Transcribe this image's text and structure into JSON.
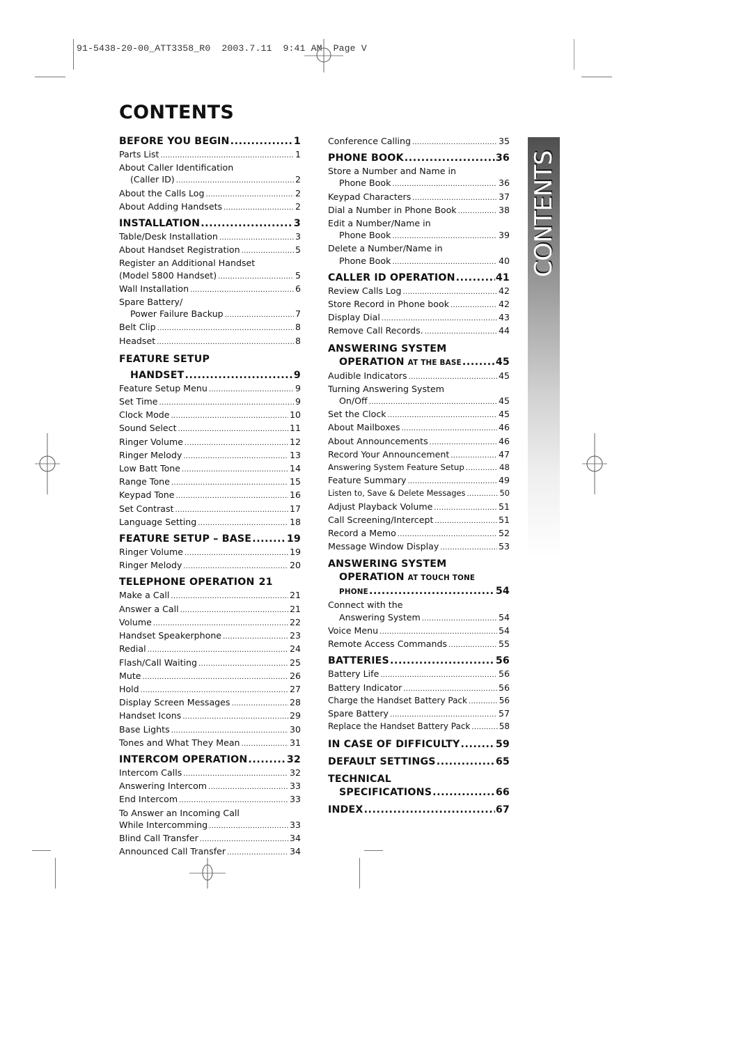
{
  "slug": {
    "text": "91-5438-20-00_ATT3358_R0  2003.7.11  9:41 AM  Page V"
  },
  "page_title": "CONTENTS",
  "side_tab_label": "CONTENTS",
  "left_column": [
    {
      "heading": "BEFORE YOU BEGIN",
      "page": "1",
      "entries": [
        {
          "title": "Parts List",
          "page": "1"
        },
        {
          "title": "About Caller Identification",
          "page": null
        },
        {
          "title": "(Caller ID)",
          "page": "2",
          "indent": true
        },
        {
          "title": "About the Calls Log",
          "page": "2"
        },
        {
          "title": "About Adding Handsets",
          "page": "2"
        }
      ]
    },
    {
      "heading": "INSTALLATION",
      "page": "3",
      "entries": [
        {
          "title": "Table/Desk Installation",
          "page": "3"
        },
        {
          "title": "About Handset Registration",
          "page": "5"
        },
        {
          "title": "Register an Additional Handset",
          "page": null
        },
        {
          "title": "(Model 5800 Handset)",
          "page": "5"
        },
        {
          "title": "Wall Installation",
          "page": "6"
        },
        {
          "title": "Spare Battery/",
          "page": null
        },
        {
          "title": "Power Failure Backup",
          "page": "7",
          "indent": true
        },
        {
          "title": "Belt Clip",
          "page": "8"
        },
        {
          "title": "Headset",
          "page": "8"
        }
      ]
    },
    {
      "heading": "FEATURE SETUP",
      "heading_line2": "HANDSET",
      "page": "9",
      "entries": [
        {
          "title": "Feature Setup Menu",
          "page": "9"
        },
        {
          "title": "Set Time",
          "page": "9"
        },
        {
          "title": "Clock Mode",
          "page": "10"
        },
        {
          "title": "Sound Select",
          "page": "11"
        },
        {
          "title": "Ringer Volume",
          "page": "12"
        },
        {
          "title": "Ringer Melody",
          "page": "13"
        },
        {
          "title": "Low Batt Tone",
          "page": "14"
        },
        {
          "title": "Range Tone",
          "page": "15"
        },
        {
          "title": "Keypad Tone",
          "page": "16"
        },
        {
          "title": "Set Contrast",
          "page": "17"
        },
        {
          "title": "Language Setting",
          "page": "18"
        }
      ]
    },
    {
      "heading": "FEATURE SETUP – BASE",
      "page": "19",
      "entries": [
        {
          "title": "Ringer Volume",
          "page": "19"
        },
        {
          "title": "Ringer Melody",
          "page": "20"
        }
      ]
    },
    {
      "heading": "TELEPHONE OPERATION",
      "page": "21",
      "entries": [
        {
          "title": "Make a Call",
          "page": "21"
        },
        {
          "title": "Answer a Call",
          "page": "21"
        },
        {
          "title": "Volume",
          "page": "22"
        },
        {
          "title": "Handset Speakerphone",
          "page": "23"
        },
        {
          "title": "Redial",
          "page": "24"
        },
        {
          "title": "Flash/Call Waiting",
          "page": "25"
        },
        {
          "title": "Mute",
          "page": "26"
        },
        {
          "title": "Hold",
          "page": "27"
        },
        {
          "title": "Display Screen Messages",
          "page": "28"
        },
        {
          "title": "Handset Icons",
          "page": "29"
        },
        {
          "title": "Base Lights",
          "page": "30"
        },
        {
          "title": "Tones and What They Mean",
          "page": "31"
        }
      ]
    },
    {
      "heading": "INTERCOM OPERATION",
      "page": "32",
      "entries": [
        {
          "title": "Intercom Calls",
          "page": "32"
        },
        {
          "title": "Answering Intercom",
          "page": "33"
        },
        {
          "title": "End Intercom",
          "page": "33"
        },
        {
          "title": "To Answer an Incoming Call",
          "page": null
        },
        {
          "title": "While Intercomming",
          "page": "33"
        },
        {
          "title": "Blind Call Transfer",
          "page": "34"
        },
        {
          "title": "Announced Call Transfer",
          "page": "34"
        }
      ]
    }
  ],
  "right_column": {
    "continued_entries": [
      {
        "title": "Conference Calling",
        "page": "35"
      }
    ],
    "sections": [
      {
        "heading": "PHONE BOOK",
        "page": "36",
        "entries": [
          {
            "title": "Store a Number and Name in",
            "page": null
          },
          {
            "title": "Phone Book",
            "page": "36",
            "indent": true
          },
          {
            "title": "Keypad Characters",
            "page": "37"
          },
          {
            "title": "Dial a Number in Phone Book",
            "page": "38"
          },
          {
            "title": "Edit a Number/Name in",
            "page": null
          },
          {
            "title": "Phone Book",
            "page": "39",
            "indent": true
          },
          {
            "title": "Delete a Number/Name in",
            "page": null
          },
          {
            "title": "Phone Book",
            "page": "40",
            "indent": true
          }
        ]
      },
      {
        "heading": "CALLER ID OPERATION",
        "page": "41",
        "entries": [
          {
            "title": "Review Calls Log",
            "page": "42"
          },
          {
            "title": "Store Record in Phone book",
            "page": "42"
          },
          {
            "title": "Display Dial",
            "page": "43"
          },
          {
            "title": "Remove Call Records.",
            "page": "44"
          }
        ]
      },
      {
        "heading": "ANSWERING SYSTEM",
        "heading_line2": "OPERATION",
        "heading_line2_small": "AT THE BASE",
        "page": "45",
        "entries": [
          {
            "title": "Audible Indicators",
            "page": "45"
          },
          {
            "title": "Turning Answering System",
            "page": null
          },
          {
            "title": "On/Off",
            "page": "45",
            "indent": true
          },
          {
            "title": "Set the Clock",
            "page": "45"
          },
          {
            "title": "About Mailboxes",
            "page": "46"
          },
          {
            "title": "About Announcements",
            "page": "46"
          },
          {
            "title": "Record Your Announcement",
            "page": "47"
          },
          {
            "title": "Answering System Feature Setup",
            "page": "48"
          },
          {
            "title": "Feature Summary",
            "page": "49"
          },
          {
            "title": "Listen to, Save & Delete Messages",
            "page": "50"
          },
          {
            "title": "Adjust Playback Volume",
            "page": "51"
          },
          {
            "title": "Call Screening/Intercept",
            "page": "51"
          },
          {
            "title": "Record a Memo",
            "page": "52"
          },
          {
            "title": "Message Window Display",
            "page": "53"
          }
        ]
      },
      {
        "heading": "ANSWERING SYSTEM",
        "heading_line2": "OPERATION",
        "heading_line2_small": "AT TOUCH TONE",
        "heading_line3_small": "PHONE",
        "page": "54",
        "entries": [
          {
            "title": "Connect with the",
            "page": null
          },
          {
            "title": "Answering System",
            "page": "54",
            "indent": true
          },
          {
            "title": "Voice Menu",
            "page": "54"
          },
          {
            "title": "Remote Access Commands",
            "page": "55"
          }
        ]
      },
      {
        "heading": "BATTERIES",
        "page": "56",
        "entries": [
          {
            "title": "Battery Life",
            "page": "56"
          },
          {
            "title": "Battery Indicator",
            "page": "56"
          },
          {
            "title": "Charge the Handset Battery Pack",
            "page": "56"
          },
          {
            "title": "Spare Battery",
            "page": "57"
          },
          {
            "title": "Replace the Handset Battery Pack",
            "page": "58"
          }
        ]
      },
      {
        "heading": "IN CASE OF DIFFICULTY",
        "page": "59",
        "entries": []
      },
      {
        "heading": "DEFAULT SETTINGS",
        "page": "65",
        "entries": []
      },
      {
        "heading": "TECHNICAL",
        "heading_line2": "SPECIFICATIONS",
        "page": "66",
        "entries": []
      },
      {
        "heading": "INDEX",
        "page": "67",
        "entries": []
      }
    ]
  }
}
